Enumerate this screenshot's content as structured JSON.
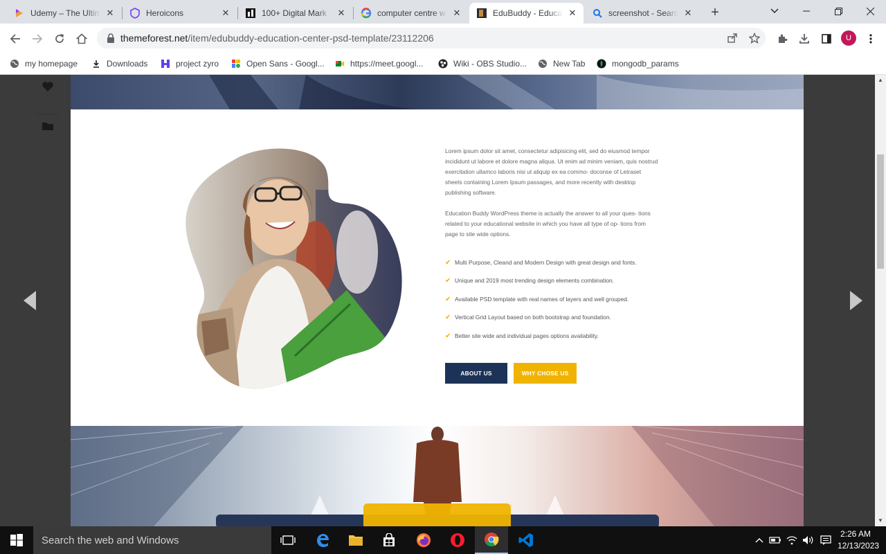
{
  "browser": {
    "tabs": [
      {
        "title": "Udemy – The Ultim",
        "icon": "udemy-icon"
      },
      {
        "title": "Heroicons",
        "icon": "heroicons-icon"
      },
      {
        "title": "100+ Digital Mark",
        "icon": "digital-marketing-icon"
      },
      {
        "title": "computer centre w",
        "icon": "google-icon"
      },
      {
        "title": "EduBuddy - Educa",
        "icon": "themeforest-icon",
        "active": true
      },
      {
        "title": "screenshot - Searc",
        "icon": "search-icon"
      }
    ],
    "url": {
      "domain": "themeforest.net",
      "path": "/item/edubuddy-education-center-psd-template/23112206"
    },
    "profile_initial": "U",
    "bookmarks": [
      {
        "label": "my homepage",
        "icon": "globe-icon"
      },
      {
        "label": "Downloads",
        "icon": "download-icon"
      },
      {
        "label": "project zyro",
        "icon": "hostinger-icon"
      },
      {
        "label": "Open Sans - Googl...",
        "icon": "google-fonts-icon"
      },
      {
        "label": "https://meet.googl...",
        "icon": "google-meet-icon"
      },
      {
        "label": "Wiki - OBS Studio...",
        "icon": "obs-icon"
      },
      {
        "label": "New Tab",
        "icon": "globe-icon"
      },
      {
        "label": "mongodb_params",
        "icon": "mongodb-icon"
      }
    ]
  },
  "content": {
    "paragraph1": "Lorem ipsum dolor sit amet, consectetur adipisicing elit, sed do eiusmod tempor incididunt ut labore et dolore magna aliqua. Ut enim ad minim veniam, quis nostrud exercitation ullamco laboris nisi ut aliquip ex ea commo- doconse of Letraset sheets containing Lorem Ipsum passages, and more recently with desktop publishing software.",
    "paragraph2": "Education Buddy WordPress theme is actually the answer to all your ques- tions related to your educational website in which you have all type of op- tions from page to site wide options.",
    "features": [
      "Multi Purpose, Cleand and Modern Design with great design and fonts.",
      "Unique and 2019 most trending design elements combination.",
      "Available PSD template with real names of layers and well grouped.",
      "Vertical Grid Layout based on both bootstrap and foundation.",
      "Better site wide and individual pages options availability."
    ],
    "buttons": {
      "about": "ABOUT US",
      "why": "WHY CHOSE US"
    },
    "colors": {
      "primary": "#1d3257",
      "accent": "#f0b400"
    }
  },
  "taskbar": {
    "search_placeholder": "Search the web and Windows",
    "apps": [
      "task-view-icon",
      "edge-icon",
      "file-explorer-icon",
      "store-icon",
      "firefox-icon",
      "opera-icon",
      "chrome-icon",
      "vscode-icon"
    ],
    "time": "2:26 AM",
    "date": "12/13/2023"
  }
}
